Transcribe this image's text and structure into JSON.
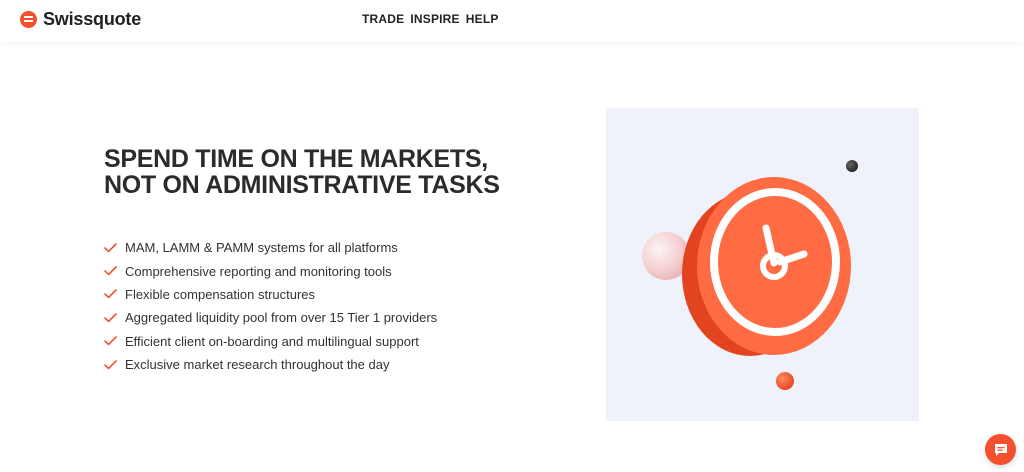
{
  "header": {
    "brand": "Swissquote",
    "nav": [
      "TRADE",
      "INSPIRE",
      "HELP"
    ]
  },
  "hero": {
    "heading": "SPEND TIME ON THE MARKETS, NOT ON ADMINISTRATIVE TASKS",
    "features": [
      "MAM, LAMM & PAMM systems for all platforms",
      "Comprehensive reporting and monitoring tools",
      "Flexible compensation structures",
      "Aggregated liquidity pool from over 15 Tier 1 providers",
      "Efficient client on-boarding and multilingual support",
      "Exclusive market research throughout the day"
    ]
  },
  "colors": {
    "accent": "#f4502e",
    "illustration_bg": "#eff2fb",
    "text": "#2b2b2b"
  },
  "icons": {
    "logo": "swissquote-logo-icon",
    "feature": "checkmark-icon",
    "chat": "chat-bubble-icon",
    "illustration": "clock-icon"
  }
}
